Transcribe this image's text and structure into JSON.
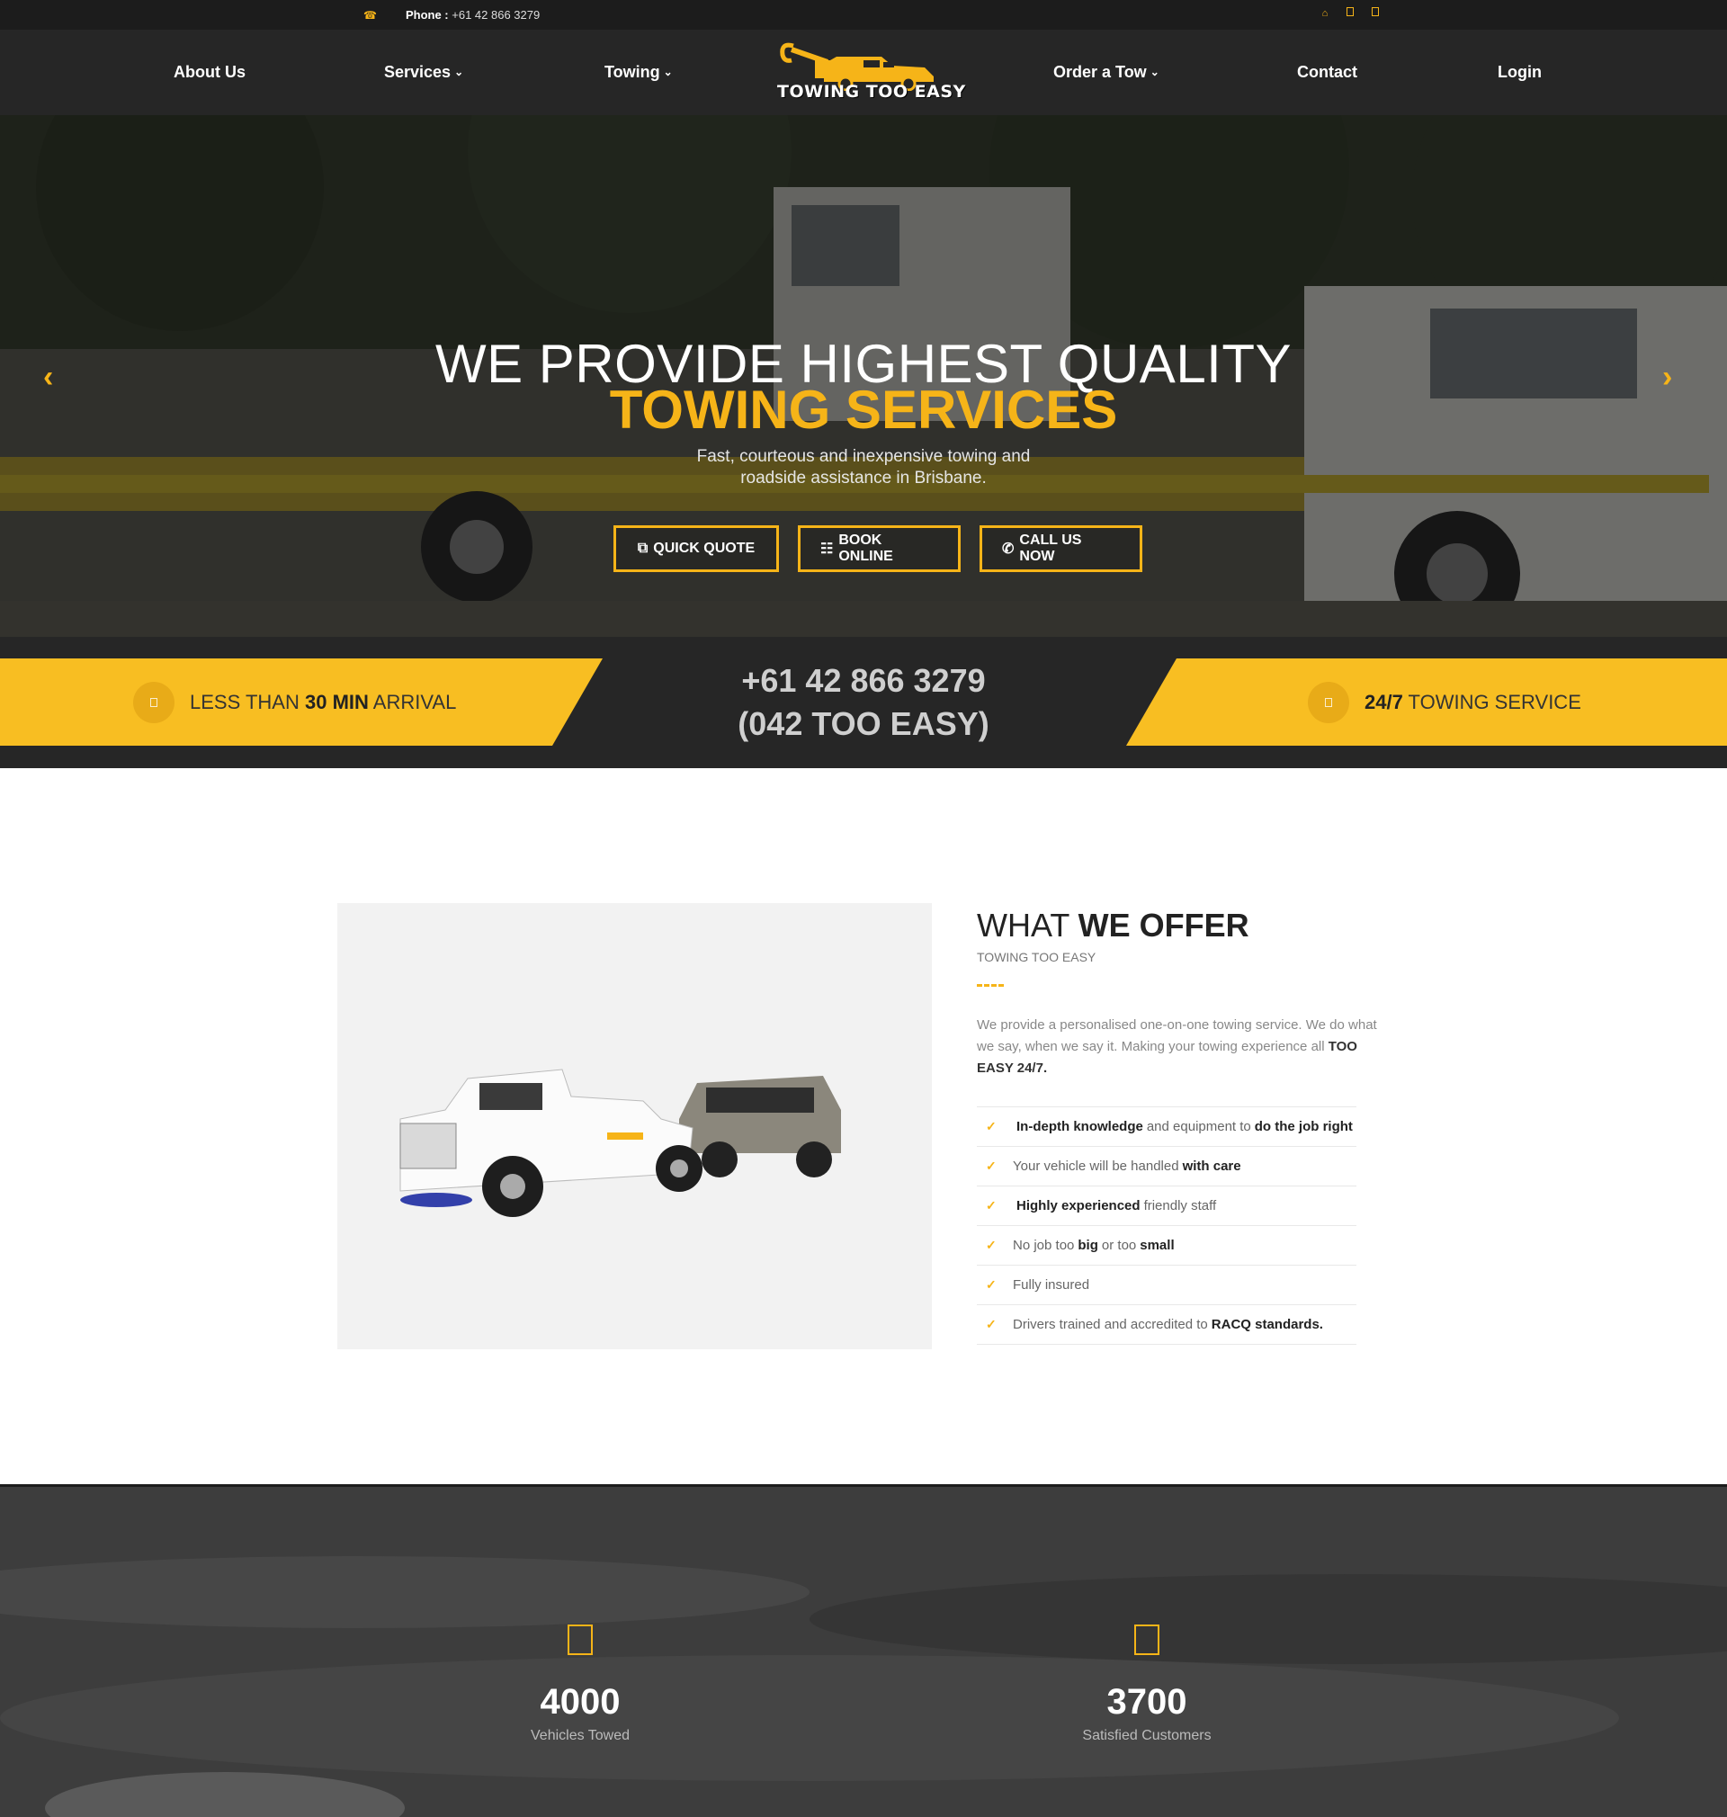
{
  "topbar": {
    "phone_label": "Phone :",
    "phone_value": "+61 42 866 3279",
    "social_icons": [
      "home-icon",
      "facebook-icon",
      "instagram-icon"
    ]
  },
  "nav": {
    "items": [
      {
        "label": "About Us",
        "has_dropdown": false
      },
      {
        "label": "Services",
        "has_dropdown": true
      },
      {
        "label": "Towing",
        "has_dropdown": true
      },
      {
        "label": "Order a Tow",
        "has_dropdown": true
      },
      {
        "label": "Contact",
        "has_dropdown": false
      },
      {
        "label": "Login",
        "has_dropdown": false
      }
    ],
    "logo_text": "TOWING TOO EASY"
  },
  "hero": {
    "title_line1": "WE PROVIDE HIGHEST QUALITY",
    "title_line2": "TOWING SERVICES",
    "subtitle": "Fast, courteous and inexpensive towing and roadside assistance in Brisbane.",
    "buttons": [
      {
        "label": "QUICK QUOTE",
        "icon": "external-link-icon"
      },
      {
        "label": "BOOK ONLINE",
        "icon": "speed-icon"
      },
      {
        "label": "CALL US NOW",
        "icon": "phone-icon"
      }
    ]
  },
  "strip": {
    "left_pre": "LESS THAN ",
    "left_bold": "30 MIN",
    "left_post": " ARRIVAL",
    "phone_line1": "+61 42 866 3279",
    "phone_line2": "(042 TOO EASY)",
    "right_bold": "24/7",
    "right_post": " TOWING SERVICE"
  },
  "offer": {
    "heading_light": "WHAT ",
    "heading_bold": "WE OFFER",
    "subheading": "TOWING TOO EASY",
    "desc": "We provide a personalised one-on-one towing service. We do what we say, when we say it. Making your towing experience all ",
    "desc_bold": "TOO EASY 24/7.",
    "features": [
      {
        "b1": "In-depth knowledge",
        "t1": "and equipment to",
        "b2": "do the job right",
        "t2": ""
      },
      {
        "b1": "",
        "t1": "Your vehicle will be handled",
        "b2": "with care",
        "t2": ""
      },
      {
        "b1": "Highly experienced",
        "t1": "friendly staff",
        "b2": "",
        "t2": ""
      },
      {
        "b1": "",
        "t1": "No job too",
        "b2": "big",
        "t2": "or too"
      },
      {
        "b1": "",
        "t1": "Fully insured",
        "b2": "",
        "t2": ""
      },
      {
        "b1": "",
        "t1": "Drivers trained and accredited to",
        "b2": "RACQ standards.",
        "t2": ""
      }
    ],
    "feature4_tail": "small"
  },
  "stats": [
    {
      "value": "4000",
      "caption": "Vehicles Towed"
    },
    {
      "value": "3700",
      "caption": "Satisfied Customers"
    }
  ],
  "colors": {
    "accent": "#f6b418",
    "dark": "#262626",
    "band": "#f8be22"
  }
}
